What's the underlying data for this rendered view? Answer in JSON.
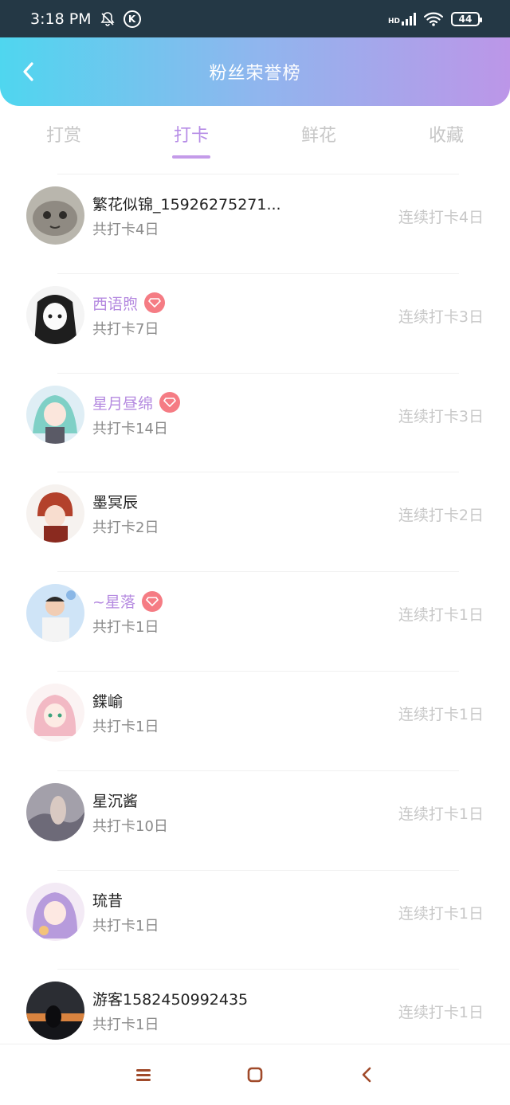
{
  "status_bar": {
    "time": "3:18 PM",
    "k_badge": "K",
    "hd": "HD",
    "battery": "44"
  },
  "header": {
    "title": "粉丝荣誉榜",
    "back_icon": "chevron-left-icon"
  },
  "tabs": [
    {
      "label": "打赏",
      "active": false
    },
    {
      "label": "打卡",
      "active": true
    },
    {
      "label": "鲜花",
      "active": false
    },
    {
      "label": "收藏",
      "active": false
    }
  ],
  "rows": [
    {
      "name": "繁花似锦_15926275271...",
      "vip": false,
      "total": "共打卡4日",
      "streak": "连续打卡4日"
    },
    {
      "name": "西语煦",
      "vip": true,
      "total": "共打卡7日",
      "streak": "连续打卡3日"
    },
    {
      "name": "星月昼绵",
      "vip": true,
      "total": "共打卡14日",
      "streak": "连续打卡3日"
    },
    {
      "name": "墨冥辰",
      "vip": false,
      "total": "共打卡2日",
      "streak": "连续打卡2日"
    },
    {
      "name": "~星落",
      "vip": true,
      "total": "共打卡1日",
      "streak": "连续打卡1日"
    },
    {
      "name": "鍱崳",
      "vip": false,
      "total": "共打卡1日",
      "streak": "连续打卡1日"
    },
    {
      "name": "星沉酱",
      "vip": false,
      "total": "共打卡10日",
      "streak": "连续打卡1日"
    },
    {
      "name": "琉昔",
      "vip": false,
      "total": "共打卡1日",
      "streak": "连续打卡1日"
    },
    {
      "name": "游客1582450992435",
      "vip": false,
      "total": "共打卡1日",
      "streak": "连续打卡1日"
    }
  ],
  "colors": {
    "accent": "#b68ce6",
    "vip_badge": "#f57c84",
    "header_start": "#4fd6ef",
    "header_end": "#bc96e8"
  },
  "nav": {
    "menu_icon": "menu-icon",
    "home_icon": "home-square-icon",
    "back_icon": "back-triangle-icon"
  }
}
